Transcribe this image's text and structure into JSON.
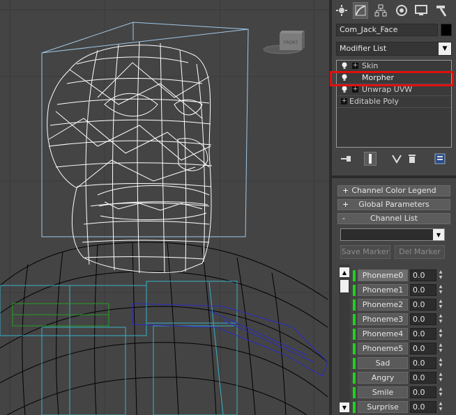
{
  "viewport": {
    "viewcube_label": "FRONT"
  },
  "command_panel": {
    "tabs": [
      {
        "name": "create",
        "icon": "sun-icon"
      },
      {
        "name": "modify",
        "icon": "bend-icon"
      },
      {
        "name": "hierarchy",
        "icon": "hierarchy-icon"
      },
      {
        "name": "motion",
        "icon": "motion-icon"
      },
      {
        "name": "display",
        "icon": "monitor-icon"
      },
      {
        "name": "utilities",
        "icon": "hammer-icon"
      }
    ],
    "object_name": "Com_Jack_Face",
    "object_color": "#000000",
    "modifier_list_label": "Modifier List",
    "stack": [
      {
        "label": "Skin",
        "has_plus": true,
        "has_bulb": true
      },
      {
        "label": "Morpher",
        "has_plus": false,
        "has_bulb": true,
        "selected": true
      },
      {
        "label": "Unwrap UVW",
        "has_plus": true,
        "has_bulb": true
      },
      {
        "label": "Editable Poly",
        "has_plus": true,
        "has_bulb": false
      }
    ],
    "highlight_color": "#e01010"
  },
  "morpher": {
    "rollouts": [
      {
        "sign": "+",
        "label": "Channel Color Legend"
      },
      {
        "sign": "+",
        "label": "Global Parameters"
      },
      {
        "sign": "-",
        "label": "Channel List"
      }
    ],
    "save_marker_label": "Save Marker",
    "del_marker_label": "Del Marker",
    "channels": [
      {
        "name": "Phoneme0",
        "value": "0.0",
        "selected": true
      },
      {
        "name": "Phoneme1",
        "value": "0.0"
      },
      {
        "name": "Phoneme2",
        "value": "0.0"
      },
      {
        "name": "Phoneme3",
        "value": "0.0"
      },
      {
        "name": "Phoneme4",
        "value": "0.0"
      },
      {
        "name": "Phoneme5",
        "value": "0.0"
      },
      {
        "name": "Sad",
        "value": "0.0"
      },
      {
        "name": "Angry",
        "value": "0.0"
      },
      {
        "name": "Smile",
        "value": "0.0"
      },
      {
        "name": "Surprise",
        "value": "0.0"
      }
    ],
    "channel_color": "#1ed21e"
  }
}
